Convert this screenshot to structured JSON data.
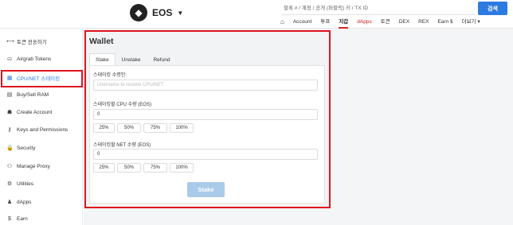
{
  "header": {
    "logo_glyph": "◆",
    "brand": "EOS",
    "brand_caret": "▼",
    "search": {
      "placeholder": "블록 # / 계정 / 공개 (퍼블릭) 키 / TX ID",
      "button": "검색"
    },
    "nav": [
      {
        "label": "⌂",
        "icon": "home-icon"
      },
      {
        "label": "Account"
      },
      {
        "label": "투표"
      },
      {
        "label": "지갑",
        "active": true
      },
      {
        "label": "dApps",
        "color": "#c81e1e"
      },
      {
        "label": "토큰"
      },
      {
        "label": "DEX"
      },
      {
        "label": "REX"
      },
      {
        "label": "Earn $"
      },
      {
        "label": "더보기 ▾"
      }
    ]
  },
  "sidebar": {
    "items": [
      {
        "label": "토큰 전송하기",
        "icon": "transfer-icon",
        "glyph": "⟷"
      },
      {
        "label": "Airgrab Tokens",
        "icon": "airgrab-icon",
        "glyph": "⛀"
      },
      {
        "label": "CPU/NET 스테이킹",
        "icon": "cpu-icon",
        "glyph": "▦",
        "active": true
      },
      {
        "label": "Buy/Sell RAM",
        "icon": "ram-icon",
        "glyph": "▤"
      },
      {
        "label": "Create Account",
        "icon": "create-account-icon",
        "glyph": "☗"
      },
      {
        "label": "Keys and Permissions",
        "icon": "key-icon",
        "glyph": "⚷"
      },
      {
        "label": "Security",
        "icon": "lock-icon",
        "glyph": "🔒"
      },
      {
        "label": "Manage Proxy",
        "icon": "users-icon",
        "glyph": "⚇"
      },
      {
        "label": "Utilities",
        "icon": "gear-icon",
        "glyph": "⚙"
      },
      {
        "label": "dApps",
        "icon": "dapps-icon",
        "glyph": "♟"
      },
      {
        "label": "Earn",
        "icon": "dollar-icon",
        "glyph": "$"
      }
    ]
  },
  "wallet": {
    "title": "Wallet",
    "tabs": [
      "Stake",
      "Unstake",
      "Refund"
    ],
    "receiver_label": "스테이킹 수령인:",
    "receiver_placeholder": "Username to receive CPU/NET",
    "cpu_label": "스테이킹할 CPU 수량 (EOS)",
    "cpu_value": "0",
    "net_label": "스테이킹할 NET 수량 (EOS)",
    "net_value": "0",
    "percents": [
      "25%",
      "50%",
      "75%",
      "100%"
    ],
    "stake_button": "Stake"
  },
  "colors": {
    "accent": "#2d7be0",
    "highlight_border": "#e0141e",
    "stake_disabled": "#a9cbe9"
  }
}
